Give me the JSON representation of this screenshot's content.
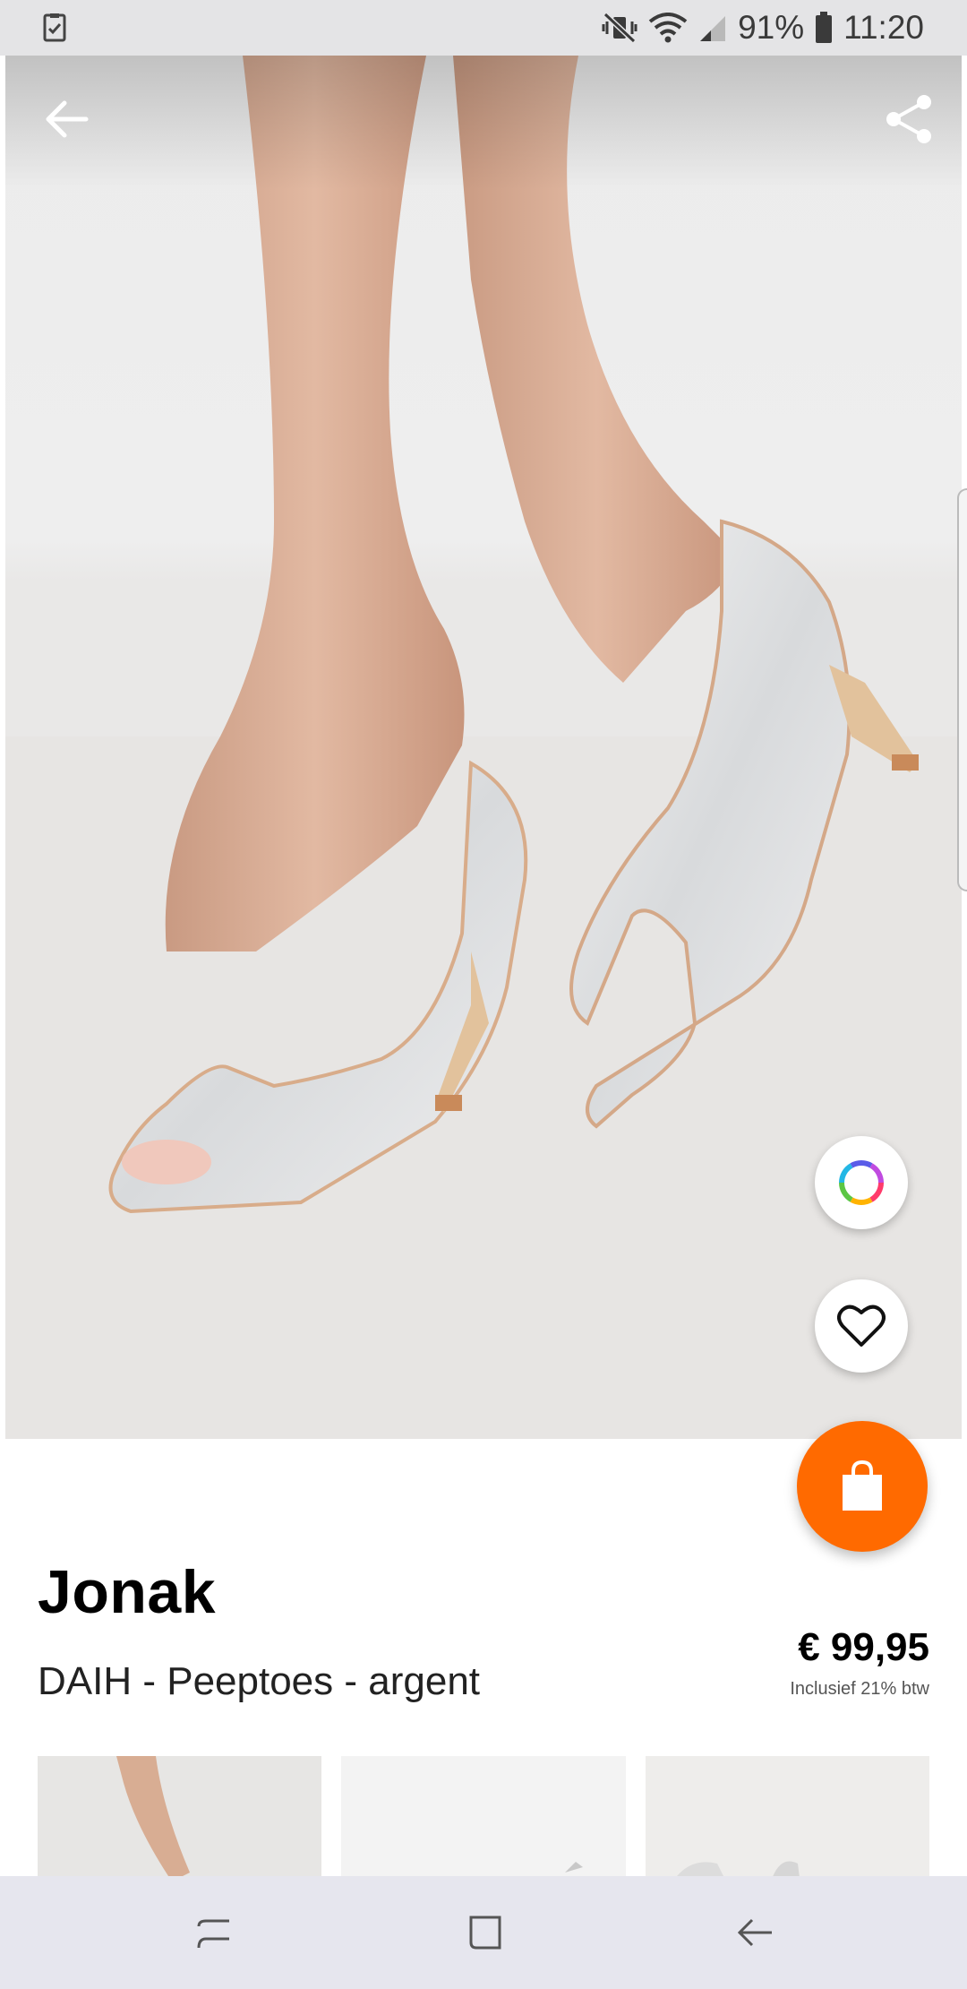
{
  "status_bar": {
    "battery": "91%",
    "time": "11:20",
    "icons": [
      "task-check-icon",
      "mute-vibrate-icon",
      "wifi-icon",
      "signal-icon",
      "battery-icon"
    ]
  },
  "toolbar": {
    "back_icon": "arrow-left-icon",
    "share_icon": "share-icon"
  },
  "fabs": {
    "color_icon": "color-ring-icon",
    "wishlist_icon": "heart-icon",
    "cart_icon": "shopping-bag-icon",
    "cart_color": "#ff6a00"
  },
  "product": {
    "brand": "Jonak",
    "name": "DAIH - Peeptoes - argent",
    "price": "€ 99,95",
    "vat_note": "Inclusief 21% btw"
  },
  "thumbnails": [
    "thumbnail-1",
    "thumbnail-2",
    "thumbnail-3"
  ],
  "nav_bar": {
    "items": [
      "recent-apps-icon",
      "home-icon",
      "back-icon"
    ]
  }
}
